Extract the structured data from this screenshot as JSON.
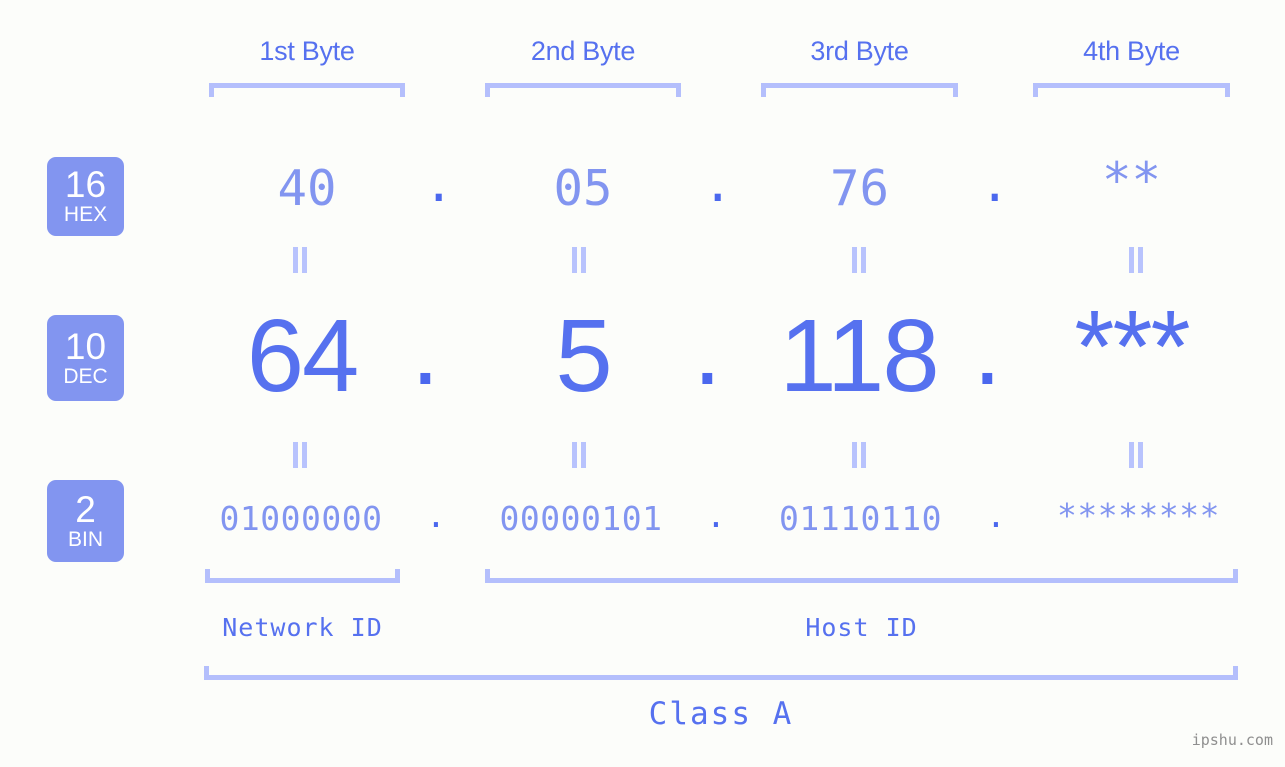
{
  "meta": {
    "watermark": "ipshu.com",
    "background": "#fcfdfa",
    "accent": "#5671ef",
    "accent_light": "#8295f0",
    "accent_pale": "#b4bffc",
    "dot_color": "#4b68ee"
  },
  "byte_headers": [
    {
      "label": "1st Byte"
    },
    {
      "label": "2nd Byte"
    },
    {
      "label": "3rd Byte"
    },
    {
      "label": "4th Byte"
    }
  ],
  "bases": [
    {
      "num": "16",
      "name": "HEX"
    },
    {
      "num": "10",
      "name": "DEC"
    },
    {
      "num": "2",
      "name": "BIN"
    }
  ],
  "rows": {
    "hex": {
      "base_num": "16",
      "base_name": "HEX",
      "values": [
        "40",
        "05",
        "76",
        "**"
      ],
      "separator": "."
    },
    "dec": {
      "base_num": "10",
      "base_name": "DEC",
      "values": [
        "64",
        "5",
        "118",
        "***"
      ],
      "separator": "."
    },
    "bin": {
      "base_num": "2",
      "base_name": "BIN",
      "values": [
        "01000000",
        "00000101",
        "01110110",
        "********"
      ],
      "separator": "."
    }
  },
  "equals_mark": "||",
  "segments": {
    "network_id": "Network ID",
    "host_id": "Host ID",
    "class": "Class A"
  },
  "chart_data": {
    "type": "table",
    "title": "IP address byte breakdown",
    "columns": [
      "1st Byte",
      "2nd Byte",
      "3rd Byte",
      "4th Byte"
    ],
    "rows": [
      {
        "base": "16 HEX",
        "values": [
          "40",
          "05",
          "76",
          "**"
        ]
      },
      {
        "base": "10 DEC",
        "values": [
          "64",
          "5",
          "118",
          "***"
        ]
      },
      {
        "base": "2 BIN",
        "values": [
          "01000000",
          "00000101",
          "01110110",
          "********"
        ]
      }
    ],
    "annotations": {
      "network_id_bytes": [
        "1st Byte"
      ],
      "host_id_bytes": [
        "2nd Byte",
        "3rd Byte",
        "4th Byte"
      ],
      "class": "Class A"
    }
  }
}
